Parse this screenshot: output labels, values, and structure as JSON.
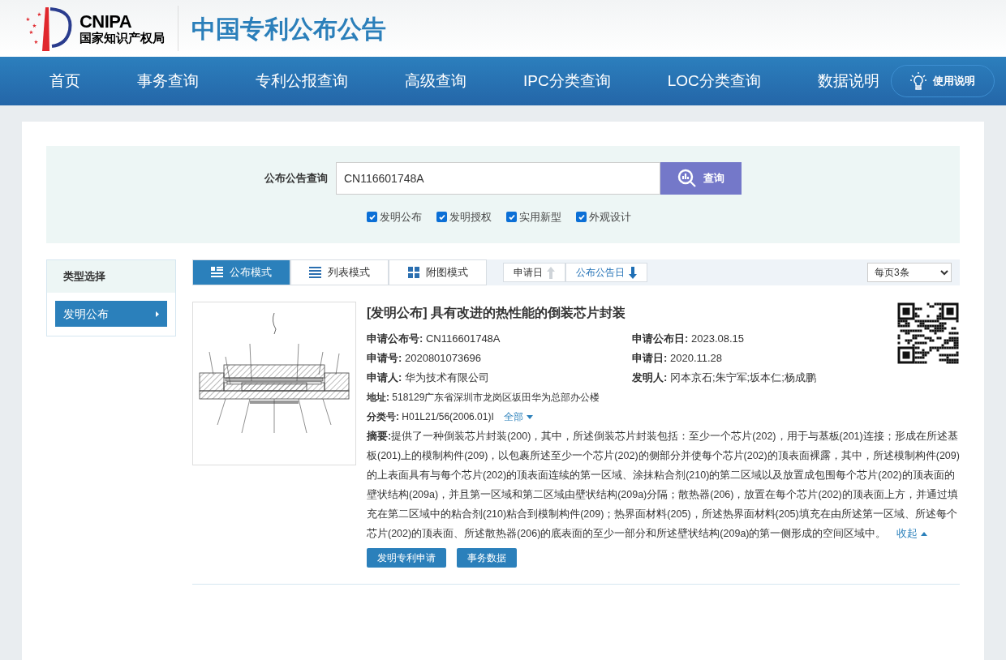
{
  "header": {
    "logo_text": "CNIPA",
    "logo_subtitle": "国家知识产权局",
    "site_title": "中国专利公布公告"
  },
  "nav": {
    "items": [
      {
        "label": "首页"
      },
      {
        "label": "事务查询"
      },
      {
        "label": "专利公报查询"
      },
      {
        "label": "高级查询"
      },
      {
        "label": "IPC分类查询"
      },
      {
        "label": "LOC分类查询"
      },
      {
        "label": "数据说明"
      }
    ],
    "help_button": "使用说明"
  },
  "search": {
    "label": "公布公告查询",
    "value": "CN116601748A",
    "button": "查询",
    "filters": [
      {
        "label": "发明公布",
        "checked": true
      },
      {
        "label": "发明授权",
        "checked": true
      },
      {
        "label": "实用新型",
        "checked": true
      },
      {
        "label": "外观设计",
        "checked": true
      }
    ]
  },
  "sidebar": {
    "title": "类型选择",
    "items": [
      {
        "label": "发明公布",
        "selected": true
      }
    ]
  },
  "toolbar": {
    "view_modes": [
      {
        "label": "公布模式",
        "kind": "publish",
        "selected": true
      },
      {
        "label": "列表模式",
        "kind": "list",
        "selected": false
      },
      {
        "label": "附图模式",
        "kind": "figure",
        "selected": false
      }
    ],
    "sorts": [
      {
        "label": "申请日",
        "kind": "up",
        "selected": false
      },
      {
        "label": "公布公告日",
        "kind": "down",
        "selected": true
      }
    ],
    "page_size": "每页3条"
  },
  "result": {
    "title": "[发明公布] 具有改进的热性能的倒装芯片封装",
    "fields_left": [
      {
        "label": "申请公布号:",
        "value": "CN116601748A"
      },
      {
        "label": "申请号:",
        "value": "2020801073696"
      },
      {
        "label": "申请人:",
        "value": "华为技术有限公司"
      }
    ],
    "fields_right": [
      {
        "label": "申请公布日:",
        "value": "2023.08.15"
      },
      {
        "label": "申请日:",
        "value": "2020.11.28"
      },
      {
        "label": "发明人:",
        "value": "冈本京石;朱宁军;坂本仁;杨成鹏"
      }
    ],
    "address": {
      "label": "地址:",
      "value": "518129广东省深圳市龙岗区坂田华为总部办公楼"
    },
    "classification": {
      "label": "分类号:",
      "value": "H01L21/56(2006.01)I",
      "more": "全部"
    },
    "abstract": {
      "label": "摘要:",
      "value": "提供了一种倒装芯片封装(200)，其中，所述倒装芯片封装包括：至少一个芯片(202)，用于与基板(201)连接；形成在所述基板(201)上的模制构件(209)，以包裹所述至少一个芯片(202)的侧部分并使每个芯片(202)的顶表面裸露，其中，所述模制构件(209)的上表面具有与每个芯片(202)的顶表面连续的第一区域、涂抹粘合剂(210)的第二区域以及放置成包围每个芯片(202)的顶表面的壁状结构(209a)，并且第一区域和第二区域由壁状结构(209a)分隔；散热器(206)，放置在每个芯片(202)的顶表面上方，并通过填充在第二区域中的粘合剂(210)粘合到模制构件(209)；热界面材料(205)，所述热界面材料(205)填充在由所述第一区域、所述每个芯片(202)的顶表面、所述散热器(206)的底表面的至少一部分和所述壁状结构(209a)的第一侧形成的空间区域中。",
      "collapse": "收起"
    },
    "buttons": [
      "发明专利申请",
      "事务数据"
    ]
  }
}
